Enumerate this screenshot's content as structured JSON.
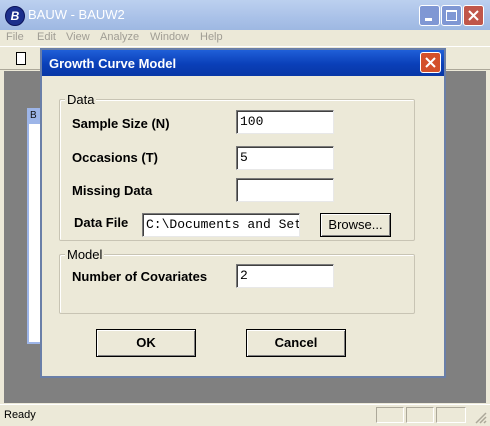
{
  "app": {
    "title": "BAUW - BAUW2",
    "icon_letter": "B",
    "icon": "app-logo-icon",
    "window_controls": [
      "minimize-icon",
      "maximize-icon",
      "close-icon"
    ],
    "menu": [
      "File",
      "Edit",
      "View",
      "Analyze",
      "Window",
      "Help"
    ],
    "toolbar": {
      "new_icon": "new-document-icon"
    },
    "child_window_label": "B",
    "status": "Ready"
  },
  "dialog": {
    "title": "Growth Curve Model",
    "close_icon": "close-icon",
    "data_group": {
      "legend": "Data",
      "sample_size": {
        "label": "Sample Size (N)",
        "value": "100"
      },
      "occasions": {
        "label": "Occasions (T)",
        "value": "5"
      },
      "missing_data": {
        "label": "Missing Data",
        "value": ""
      },
      "data_file": {
        "label": "Data File",
        "value": "C:\\Documents and Settin"
      },
      "browse_label": "Browse..."
    },
    "model_group": {
      "legend": "Model",
      "covariates": {
        "label": "Number of Covariates",
        "value": "2"
      }
    },
    "ok_label": "OK",
    "cancel_label": "Cancel"
  },
  "colors": {
    "dialog_title_blue": "#0a3fb8",
    "inactive_title": "#a9c1e8",
    "face": "#ece9d8",
    "close_red": "#d3502b"
  }
}
